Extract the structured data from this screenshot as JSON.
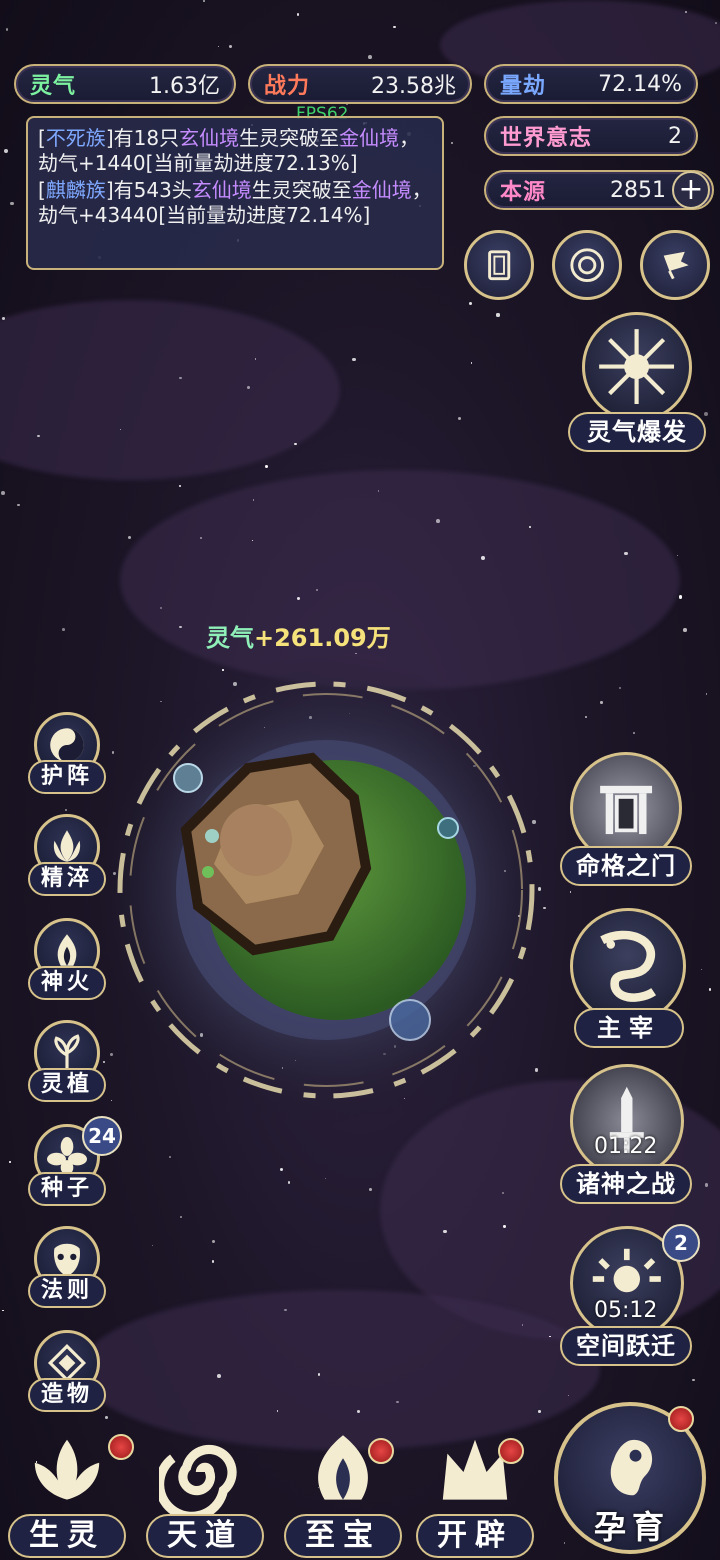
{
  "stats": {
    "lingqi": {
      "label": "灵气",
      "value": "1.63亿",
      "color": "#7cf2a0"
    },
    "zhanli": {
      "label": "战力",
      "value": "23.58兆",
      "color": "#ff7a5a"
    },
    "liangjie": {
      "label": "量劫",
      "value": "72.14%",
      "color": "#7aa8ff"
    },
    "world_will": {
      "label": "世界意志",
      "value": "2",
      "color": "#ff9bd0"
    },
    "origin": {
      "label": "本源",
      "value": "2851",
      "color": "#ff88c8",
      "plus": "+"
    }
  },
  "fps": "FPS62",
  "log": [
    {
      "pre": "[",
      "race": "不死族",
      "mid1": "]有18只",
      "realm1": "玄仙境",
      "mid2": "生灵突破至",
      "realm2": "金仙境",
      "post": "，劫气+1440[当前量劫进度72.13%]"
    },
    {
      "pre": "[",
      "race": "麒麟族",
      "mid1": "]有543头",
      "realm1": "玄仙境",
      "mid2": "生灵突破至",
      "realm2": "金仙境",
      "post": "，劫气+43440[当前量劫进度72.14%]"
    }
  ],
  "top_icons": [
    {
      "name": "card-icon"
    },
    {
      "name": "vortex-icon"
    },
    {
      "name": "flag-icon"
    }
  ],
  "lingqi_burst": {
    "label": "灵气爆发"
  },
  "planet": {
    "gain_label": "灵气",
    "gain_value": "+261.09万"
  },
  "left_menu": [
    {
      "label": "护阵",
      "icon": "yin-yang-icon"
    },
    {
      "label": "精淬",
      "icon": "lotus-flame-icon"
    },
    {
      "label": "神火",
      "icon": "fire-icon"
    },
    {
      "label": "灵植",
      "icon": "plant-icon"
    },
    {
      "label": "种子",
      "icon": "flower-icon",
      "badge": "24"
    },
    {
      "label": "法则",
      "icon": "mask-icon"
    },
    {
      "label": "造物",
      "icon": "diamond-icon"
    }
  ],
  "right_menu": [
    {
      "label": "命格之门",
      "icon": "gate-icon"
    },
    {
      "label": "主宰",
      "icon": "dragon-icon"
    },
    {
      "label": "诸神之战",
      "icon": "sword-icon",
      "timer": "01:22"
    },
    {
      "label": "空间跃迁",
      "icon": "sun-icon",
      "timer": "05:12",
      "badge": "2"
    }
  ],
  "bottom_menu": [
    {
      "label": "生灵",
      "icon": "lotus-icon"
    },
    {
      "label": "天道",
      "icon": "swirl-icon"
    },
    {
      "label": "至宝",
      "icon": "flame-treasure-icon"
    },
    {
      "label": "开辟",
      "icon": "crown-icon"
    }
  ],
  "nurture": {
    "label": "孕育",
    "icon": "embryo-icon"
  }
}
